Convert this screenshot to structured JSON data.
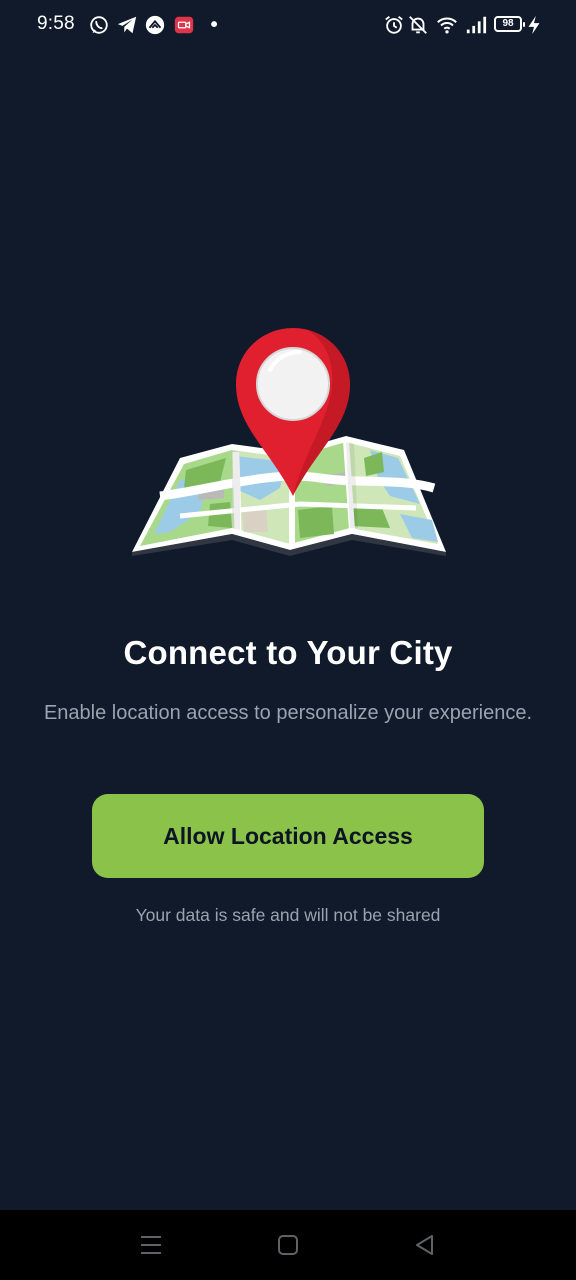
{
  "status_bar": {
    "time": "9:58",
    "battery_level": "98",
    "icons_left": [
      "whatsapp-icon",
      "telegram-icon",
      "app-notification-icon",
      "screen-recorder-icon",
      "dot-icon"
    ],
    "icons_right": [
      "alarm-icon",
      "bell-muted-icon",
      "wifi-icon",
      "signal-icon",
      "battery-icon",
      "charging-icon"
    ]
  },
  "illustration": {
    "icon": "map-location-pin-icon",
    "pin_color": "#e0202f",
    "map_green": "#8bc34a",
    "map_water": "#9ccbe8"
  },
  "main": {
    "title": "Connect to Your City",
    "subtitle": "Enable location access to personalize your experience.",
    "allow_button_label": "Allow Location Access",
    "footnote": "Your data is safe and will not be shared",
    "accent_color": "#8bc34a",
    "background_color": "#101a2b"
  },
  "nav_bar": {
    "items": [
      "menu-icon",
      "home-icon",
      "back-icon"
    ]
  }
}
